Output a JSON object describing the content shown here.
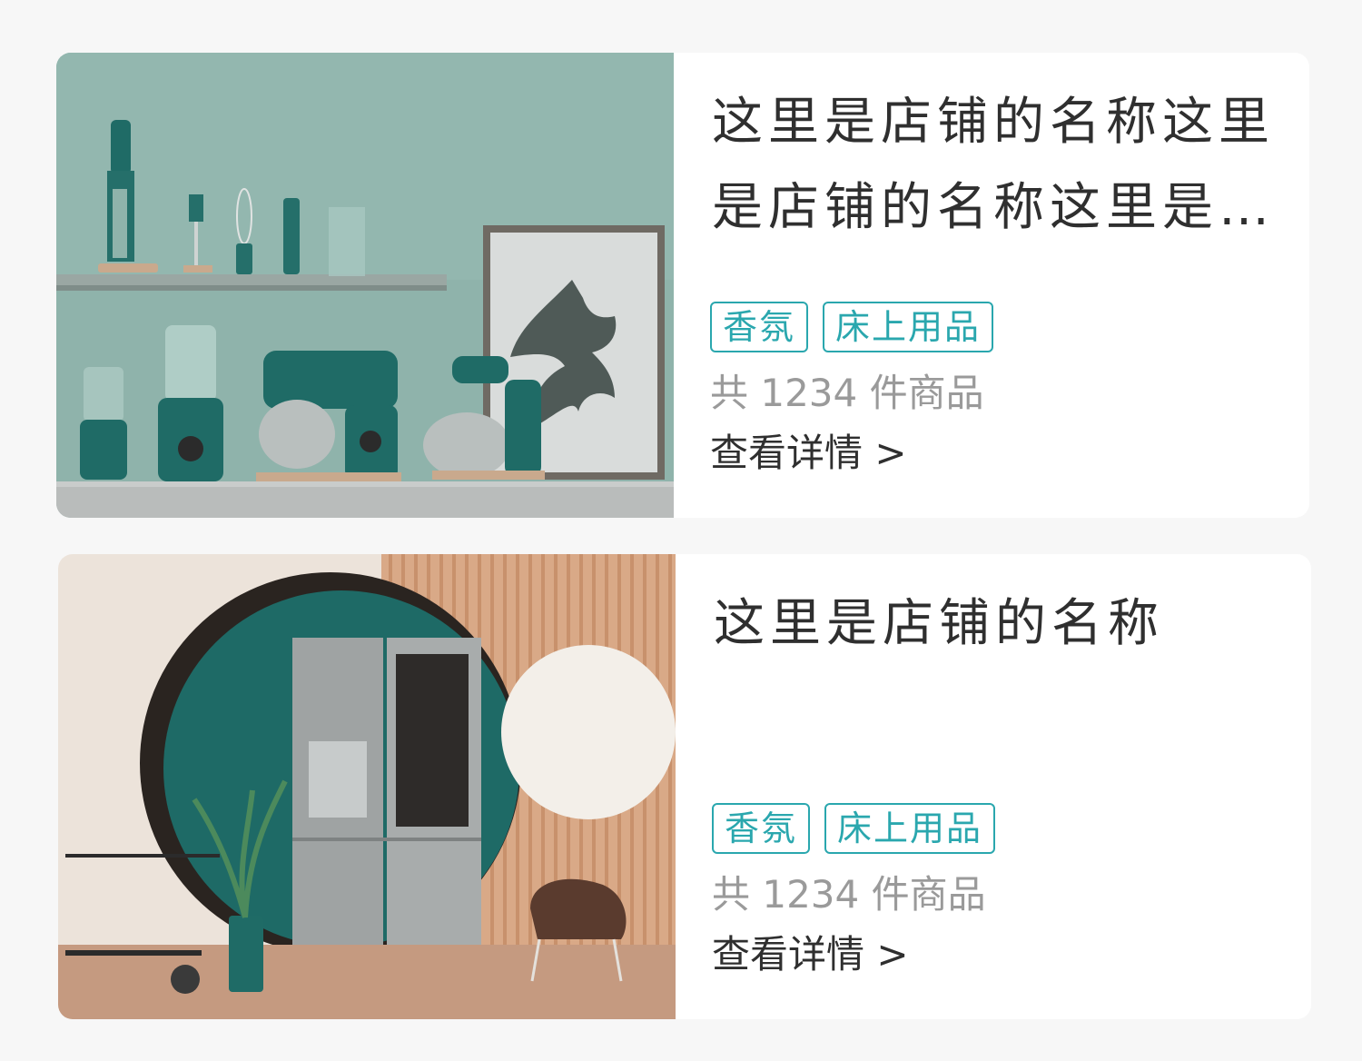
{
  "shops": [
    {
      "name": "这里是店铺的名称这里是店铺的名称这里是店铺的名称",
      "tags": [
        "香氛",
        "床上用品"
      ],
      "count_text": "共 1234 件商品",
      "detail_label": "查看详情 >"
    },
    {
      "name": "这里是店铺的名称",
      "tags": [
        "香氛",
        "床上用品"
      ],
      "count_text": "共 1234 件商品",
      "detail_label": "查看详情 >"
    }
  ],
  "colors": {
    "accent": "#2aa7ae",
    "title": "#2f2f2f",
    "muted": "#9a9a9a",
    "background": "#f7f7f7",
    "card": "#ffffff"
  }
}
